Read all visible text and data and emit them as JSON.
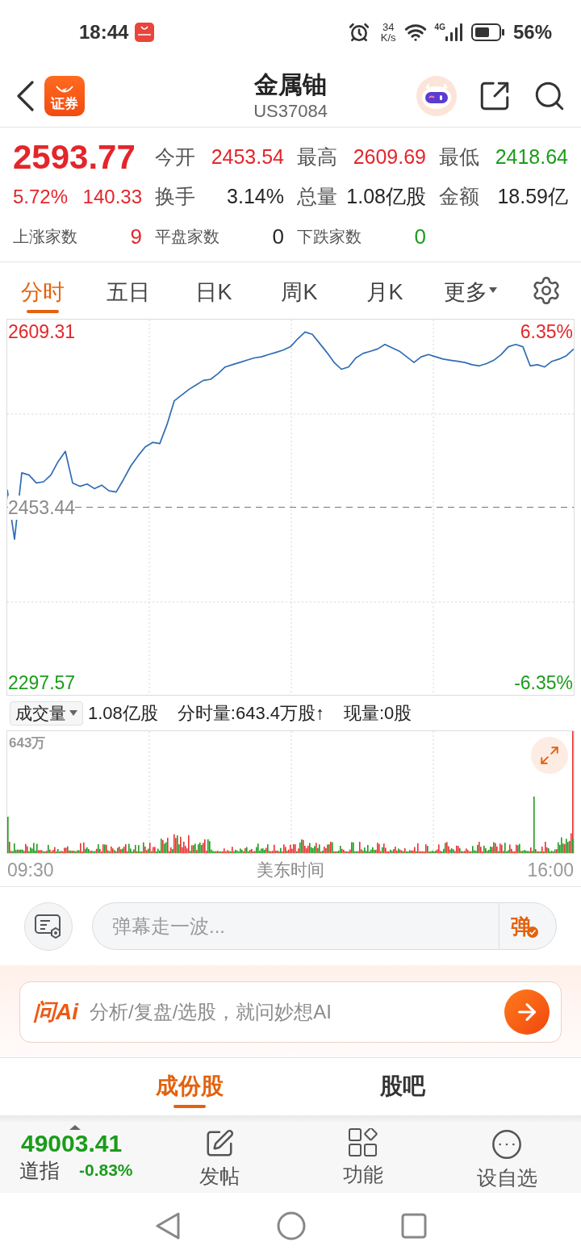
{
  "status_bar": {
    "time": "18:44",
    "speed_value": "34",
    "speed_unit": "K/s",
    "network_type": "4G",
    "battery": "56%"
  },
  "header": {
    "app_badge": "证券",
    "title": "金属铀",
    "code": "US37084"
  },
  "quote": {
    "price": "2593.77",
    "change_pct": "5.72%",
    "change": "140.33",
    "color": "#e3262b",
    "stats": [
      {
        "label": "今开",
        "value": "2453.54",
        "color": "#e3262b"
      },
      {
        "label": "最高",
        "value": "2609.69",
        "color": "#e3262b"
      },
      {
        "label": "最低",
        "value": "2418.64",
        "color": "#1b9c1b"
      },
      {
        "label": "换手",
        "value": "3.14%",
        "color": "#262626"
      },
      {
        "label": "总量",
        "value": "1.08亿股",
        "color": "#262626"
      },
      {
        "label": "金额",
        "value": "18.59亿",
        "color": "#262626"
      }
    ],
    "breadth": [
      {
        "label": "上涨家数",
        "value": "9",
        "color": "#e3262b"
      },
      {
        "label": "平盘家数",
        "value": "0",
        "color": "#262626"
      },
      {
        "label": "下跌家数",
        "value": "0",
        "color": "#1b9c1b"
      }
    ]
  },
  "chart_tabs": [
    {
      "label": "分时",
      "selected": true,
      "kind": "tab"
    },
    {
      "label": "五日",
      "selected": false,
      "kind": "tab"
    },
    {
      "label": "日K",
      "selected": false,
      "kind": "tab"
    },
    {
      "label": "周K",
      "selected": false,
      "kind": "tab"
    },
    {
      "label": "月K",
      "selected": false,
      "kind": "tab"
    },
    {
      "label": "更多",
      "selected": false,
      "kind": "menu"
    }
  ],
  "price_chart": {
    "top_pct": "6.35%",
    "bottom_pct": "-6.35%",
    "chart_data": {
      "type": "line",
      "categories": [
        null,
        null,
        null,
        null,
        null,
        null,
        null,
        null,
        null,
        null,
        null,
        null,
        null,
        null,
        null,
        null,
        null,
        null,
        null,
        null,
        null,
        null,
        null,
        null,
        null,
        null,
        null,
        null,
        null,
        null,
        null,
        null,
        null,
        null,
        null,
        null,
        null,
        null,
        null,
        null,
        null,
        null,
        null,
        null,
        null,
        null,
        null,
        null,
        null,
        null,
        null,
        null,
        null,
        null,
        null,
        null,
        null,
        null,
        null,
        null,
        null,
        null,
        null,
        null,
        null,
        null,
        null,
        null,
        null,
        null,
        null,
        null,
        null,
        null,
        null,
        null,
        null,
        null,
        null
      ],
      "values": [
        2469,
        2425,
        2484,
        2482,
        2475,
        2476,
        2482,
        2494,
        2503,
        2475,
        2472,
        2474,
        2470,
        2473,
        2468,
        2467,
        2478,
        2490,
        2499,
        2507,
        2511,
        2510,
        2527,
        2548,
        2553,
        2558,
        2562,
        2566,
        2567,
        2572,
        2578,
        2580,
        2582,
        2584,
        2586,
        2587,
        2589,
        2591,
        2593,
        2596,
        2603,
        2609,
        2607,
        2599,
        2591,
        2582,
        2576,
        2578,
        2586,
        2590,
        2592,
        2594,
        2598,
        2595,
        2592,
        2587,
        2582,
        2587,
        2589,
        2587,
        2585,
        2584,
        2583,
        2582,
        2580,
        2579,
        2581,
        2584,
        2589,
        2596,
        2598,
        2596,
        2579,
        2580,
        2578,
        2583,
        2585,
        2588,
        2594
      ],
      "ylim": [
        2286.82,
        2620.06
      ],
      "yticks": [
        {
          "value": 2609.31,
          "label": "2609.31"
        },
        {
          "value": 2453.44,
          "label": "2453.44"
        },
        {
          "value": 2297.57,
          "label": "2297.57"
        }
      ],
      "ref_lines": [
        {
          "axis": "y",
          "value": 2453.44
        }
      ]
    }
  },
  "volume": {
    "indicator": "成交量",
    "total": "1.08亿股",
    "minute_volume": "分时量:643.4万股↑",
    "current": "现量:0股",
    "max_label": "643万"
  },
  "time_axis": {
    "start": "09:30",
    "zone": "美东时间",
    "end": "16:00"
  },
  "danmu": {
    "placeholder": "弹幕走一波...",
    "send": "弹"
  },
  "ai_bar": {
    "logo": "问Ai",
    "placeholder": "分析/复盘/选股，就问妙想AI"
  },
  "section_tabs": [
    {
      "label": "成份股",
      "selected": true
    },
    {
      "label": "股吧",
      "selected": false
    }
  ],
  "bottom_bar": {
    "index": {
      "value": "49003.41",
      "name": "道指",
      "change": "-0.83%",
      "color": "#1b9c1b"
    },
    "actions": [
      {
        "label": "发帖",
        "kind": "post"
      },
      {
        "label": "功能",
        "kind": "functions"
      },
      {
        "label": "设自选",
        "kind": "watchlist"
      }
    ]
  }
}
